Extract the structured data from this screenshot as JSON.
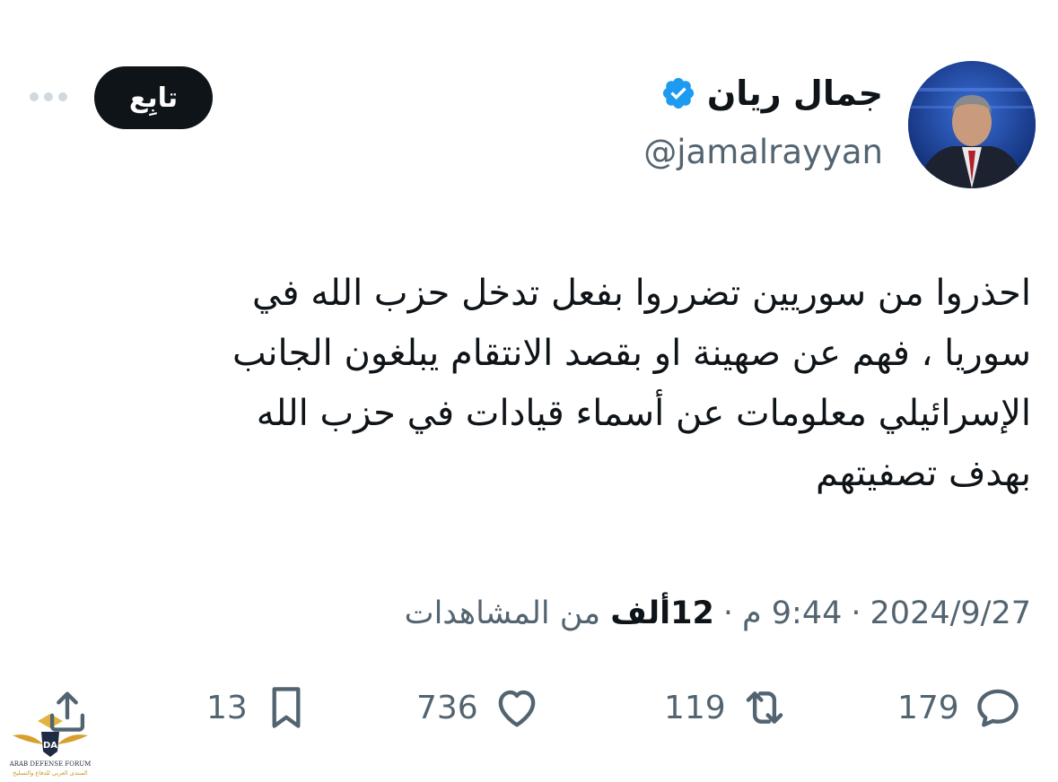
{
  "author": {
    "display_name": "جمال ريان",
    "handle": "@jamalrayyan",
    "verified": true,
    "verified_color": "#1d9bf0"
  },
  "follow_label": "تابِع",
  "tweet": {
    "text": "احذروا من سوريين تضرروا بفعل تدخل حزب الله في\nسوريا ، فهم عن صهينة او بقصد الانتقام يبلغون الجانب\nالإسرائيلي معلومات عن أسماء قيادات في حزب الله\nبهدف تصفيتهم"
  },
  "meta": {
    "date": "2024/9/27",
    "time": "9:44 م",
    "views_count": "12ألف",
    "views_label": "من المشاهدات",
    "separator": "·"
  },
  "actions": {
    "replies": "179",
    "retweets": "119",
    "likes": "736",
    "bookmarks": "13"
  },
  "watermark": {
    "logo_text": "DA",
    "line1": "ARAB DEFENSE FORUM",
    "line2": "المنتدى العربي للدفاع والتسليح"
  }
}
